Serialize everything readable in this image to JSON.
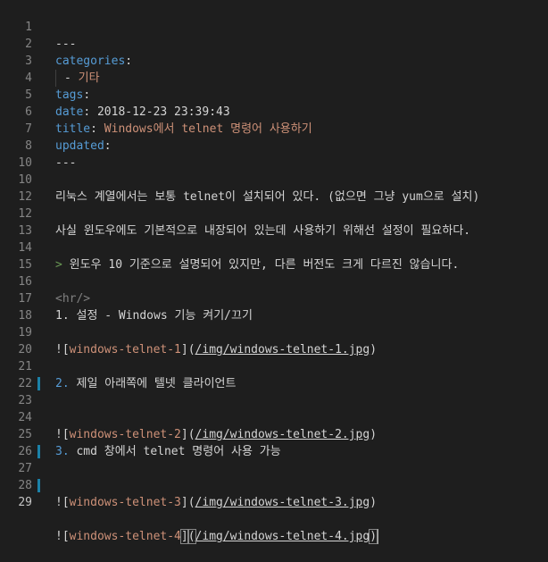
{
  "lines": [
    {
      "num": "1",
      "text": "---"
    },
    {
      "num": "2",
      "key": "categories",
      "colon": ":"
    },
    {
      "num": "3",
      "dash": "- ",
      "value": "기타"
    },
    {
      "num": "4",
      "key": "tags",
      "colon": ":"
    },
    {
      "num": "5",
      "key": "date",
      "colon": ": ",
      "value": "2018-12-23 23:39:43"
    },
    {
      "num": "6",
      "key": "title",
      "colon": ": ",
      "value": "Windows에서 telnet 명령어 사용하기"
    },
    {
      "num": "7",
      "key": "updated",
      "colon": ":"
    },
    {
      "num": "8",
      "text": "---"
    },
    {
      "num": "10",
      "text": ""
    },
    {
      "num": "10",
      "text": "리눅스 계열에서는 보통 telnet이 설치되어 있다. (없으면 그냥 yum으로 설치)"
    },
    {
      "num": "12",
      "text": ""
    },
    {
      "num": "12",
      "text": "사실 윈도우에도 기본적으로 내장되어 있는데 사용하기 위해선 설정이 필요하다."
    },
    {
      "num": "13",
      "text": ""
    },
    {
      "num": "14",
      "marker": ">",
      "text": " 윈도우 10 기준으로 설명되어 있지만, 다른 버전도 크게 다르진 않습니다."
    },
    {
      "num": "15",
      "text": ""
    },
    {
      "num": "16",
      "tag": "<hr/>"
    },
    {
      "num": "17",
      "text": "1. 설정 - Windows 기능 켜기/끄기"
    },
    {
      "num": "18",
      "text": ""
    },
    {
      "num": "19",
      "open": "![",
      "alt": "windows-telnet-1",
      "mid": "](",
      "url": "/img/windows-telnet-1.jpg",
      "close": ")"
    },
    {
      "num": "20",
      "text": ""
    },
    {
      "num": "21",
      "listnum": "2.",
      "text": " 제일 아래쪽에 텔넷 클라이언트"
    },
    {
      "num": "22",
      "text": ""
    },
    {
      "num": "23",
      "open": "![",
      "alt": "windows-telnet-2",
      "mid": "](",
      "url": "/img/windows-telnet-2.jpg",
      "close": ")"
    },
    {
      "num": "24",
      "text": ""
    },
    {
      "num": "25",
      "listnum": "3.",
      "text": " cmd 창에서 telnet 명령어 사용 가능"
    },
    {
      "num": "26",
      "text": ""
    },
    {
      "num": "27",
      "open": "![",
      "alt": "windows-telnet-3",
      "mid": "](",
      "url": "/img/windows-telnet-3.jpg",
      "close": ")"
    },
    {
      "num": "28",
      "text": ""
    },
    {
      "num": "29",
      "open": "![",
      "alt": "windows-telnet-4",
      "mid": "](",
      "url": "/img/windows-telnet-4.jpg",
      "close": ")"
    }
  ],
  "colors": {
    "background": "#1e1e1e",
    "keyword": "#569cd6",
    "string": "#ce9178",
    "text": "#d4d4d4",
    "line_number": "#858585",
    "modified_bar": "#1b81a8"
  }
}
